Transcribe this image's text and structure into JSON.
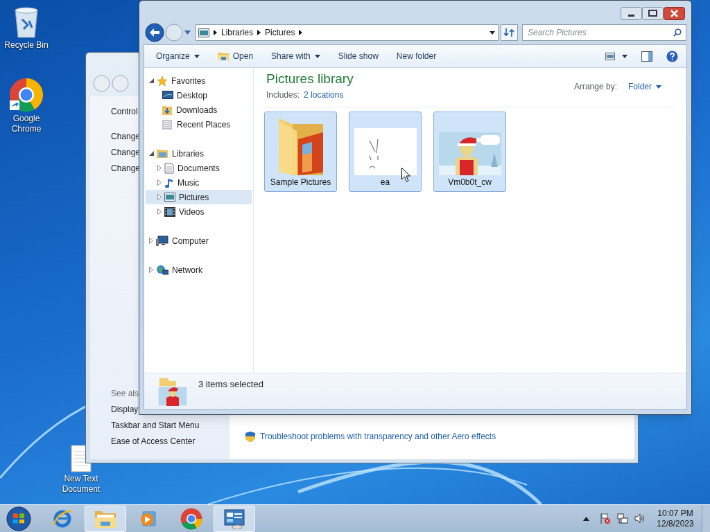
{
  "desktop": {
    "icons": [
      {
        "label": "Recycle Bin",
        "kind": "recycle"
      },
      {
        "label": "Google Chrome",
        "kind": "chrome"
      },
      {
        "label": "New Text Document",
        "kind": "text"
      }
    ]
  },
  "background_window": {
    "nav_link": "Control",
    "tasks": [
      "Change",
      "Change",
      "Change"
    ],
    "see_also_heading": "See als",
    "see_also": [
      "Display",
      "Taskbar and Start Menu",
      "Ease of Access Center"
    ],
    "troubleshoot_link": "Troubleshoot problems with transparency and other Aero effects"
  },
  "explorer": {
    "breadcrumb": [
      "Libraries",
      "Pictures"
    ],
    "search": {
      "placeholder": "Search Pictures"
    },
    "toolbar": [
      {
        "label": "Organize",
        "kind": "menu"
      },
      {
        "label": "Open",
        "kind": "icon"
      },
      {
        "label": "Share with",
        "kind": "menu"
      },
      {
        "label": "Slide show",
        "kind": "plain"
      },
      {
        "label": "New folder",
        "kind": "plain"
      }
    ],
    "nav": [
      {
        "label": "Favorites",
        "kind": "star",
        "expanded": true,
        "selected": false,
        "children": [
          {
            "label": "Desktop",
            "kind": "desktop",
            "selected": false
          },
          {
            "label": "Downloads",
            "kind": "downloads",
            "selected": false
          },
          {
            "label": "Recent Places",
            "kind": "recent",
            "selected": false
          }
        ]
      },
      {
        "label": "Libraries",
        "kind": "library",
        "expanded": true,
        "selected": false,
        "children": [
          {
            "label": "Documents",
            "kind": "documents",
            "expanded": false,
            "selected": false
          },
          {
            "label": "Music",
            "kind": "music",
            "expanded": false,
            "selected": false
          },
          {
            "label": "Pictures",
            "kind": "pictures",
            "expanded": false,
            "selected": true
          },
          {
            "label": "Videos",
            "kind": "videos",
            "expanded": false,
            "selected": false
          }
        ]
      },
      {
        "label": "Computer",
        "kind": "computer",
        "expanded": false,
        "selected": false
      },
      {
        "label": "Network",
        "kind": "network",
        "expanded": false,
        "selected": false
      }
    ],
    "library_title": "Pictures library",
    "includes_label": "Includes:",
    "includes_link": "2 locations",
    "arrange_label": "Arrange by:",
    "arrange_value": "Folder",
    "items": [
      {
        "name": "Sample Pictures",
        "kind": "folder",
        "selected": true
      },
      {
        "name": "ea",
        "kind": "sketch",
        "selected": true
      },
      {
        "name": "Vm0b0t_cw",
        "kind": "picture",
        "selected": true
      }
    ],
    "status": "3 items selected"
  },
  "taskbar": {
    "apps": [
      {
        "kind": "ie",
        "selected": false
      },
      {
        "kind": "explorer",
        "selected": true
      },
      {
        "kind": "media",
        "selected": false
      },
      {
        "kind": "chrome",
        "selected": false
      },
      {
        "kind": "control",
        "selected": true
      }
    ],
    "time": "10:07 PM",
    "date": "12/8/2023"
  }
}
